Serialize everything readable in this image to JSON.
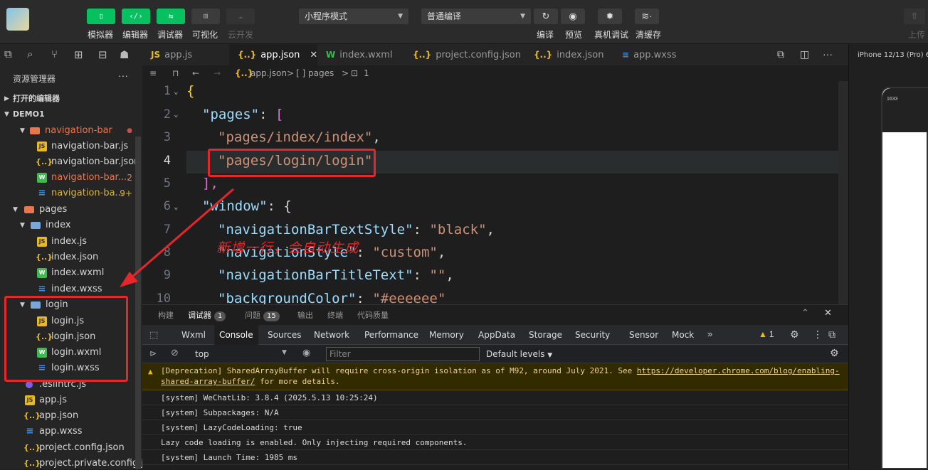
{
  "toolbar": {
    "buttons": [
      {
        "label": "模拟器",
        "icon": "phone-icon"
      },
      {
        "label": "编辑器",
        "icon": "code-icon"
      },
      {
        "label": "调试器",
        "icon": "debug-icon"
      },
      {
        "label": "可视化",
        "icon": "layout-icon"
      },
      {
        "label": "云开发",
        "icon": "cloud-icon"
      }
    ],
    "mode_select": "小程序模式",
    "compile_select": "普通编译",
    "actions": [
      "编译",
      "预览",
      "真机调试",
      "清缓存"
    ],
    "upload": "上传"
  },
  "explorer": {
    "title": "资源管理器",
    "more": "···",
    "open_editors": "打开的编辑器",
    "project": "DEMO1",
    "items": [
      {
        "name": "navigation-bar",
        "type": "folder",
        "badge": "●"
      },
      {
        "name": "navigation-bar.js",
        "type": "js"
      },
      {
        "name": "navigation-bar.json",
        "type": "json"
      },
      {
        "name": "navigation-bar....",
        "type": "wxml",
        "badge": "2"
      },
      {
        "name": "navigation-ba...",
        "type": "wxss",
        "badge": "9+"
      },
      {
        "name": "pages",
        "type": "folder"
      },
      {
        "name": "index",
        "type": "folder"
      },
      {
        "name": "index.js",
        "type": "js"
      },
      {
        "name": "index.json",
        "type": "json"
      },
      {
        "name": "index.wxml",
        "type": "wxml"
      },
      {
        "name": "index.wxss",
        "type": "wxss"
      },
      {
        "name": "login",
        "type": "folder"
      },
      {
        "name": "login.js",
        "type": "js"
      },
      {
        "name": "login.json",
        "type": "json"
      },
      {
        "name": "login.wxml",
        "type": "wxml"
      },
      {
        "name": "login.wxss",
        "type": "wxss"
      },
      {
        "name": ".eslintrc.js",
        "type": "eslint"
      },
      {
        "name": "app.js",
        "type": "js"
      },
      {
        "name": "app.json",
        "type": "json"
      },
      {
        "name": "app.wxss",
        "type": "wxss"
      },
      {
        "name": "project.config.json",
        "type": "json"
      },
      {
        "name": "project.private.config.js...",
        "type": "json"
      }
    ]
  },
  "tabs": [
    {
      "label": "app.js",
      "icon": "JS"
    },
    {
      "label": "app.json",
      "icon": "{..}",
      "active": true
    },
    {
      "label": "index.wxml",
      "icon": "W"
    },
    {
      "label": "project.config.json",
      "icon": "{..}"
    },
    {
      "label": "index.json",
      "icon": "{..}"
    },
    {
      "label": "app.wxss",
      "icon": "≡"
    }
  ],
  "close_glyph": "✕",
  "breadcrumb": {
    "file": "app.json",
    "sep1": ">",
    "node": "[ ] pages",
    "sep2": ">",
    "leaf": "1"
  },
  "code": {
    "line_numbers": [
      "1",
      "2",
      "3",
      "4",
      "5",
      "6",
      "7",
      "8",
      "9",
      "10"
    ],
    "l1": "{",
    "l2_key": "\"pages\"",
    "l2_rest": ": ",
    "l2_br": "[",
    "l3": "\"pages/index/index\"",
    "l3_comma": ",",
    "l4": "\"pages/login/login\"",
    "l5": "],",
    "l6_key": "\"window\"",
    "l6_rest": ": {",
    "l7_key": "\"navigationBarTextStyle\"",
    "l7_val": "\"black\"",
    "l8_key": "\"navigationStyle\"",
    "l8_val": "\"custom\"",
    "l9_key": "\"navigationBarTitleText\"",
    "l9_val": "\"\"",
    "l10_key": "\"backgroundColor\"",
    "l10_val": "\"#eeeeee\""
  },
  "annotation": "新增一行，会自动生成",
  "panel": {
    "tabs": [
      {
        "label": "构建"
      },
      {
        "label": "调试器",
        "badge": "1",
        "active": true
      },
      {
        "label": "问题",
        "badge": "15"
      },
      {
        "label": "输出"
      },
      {
        "label": "终端"
      },
      {
        "label": "代码质量"
      }
    ],
    "devtools_tabs": [
      "Wxml",
      "Console",
      "Sources",
      "Network",
      "Performance",
      "Memory",
      "AppData",
      "Storage",
      "Security",
      "Sensor",
      "Mock"
    ],
    "more": "»",
    "warning_count": "1",
    "context": "top",
    "filter_placeholder": "Filter",
    "levels": "Default levels",
    "logs": {
      "warn_pre": "[Deprecation] SharedArrayBuffer will require cross-origin isolation as of M92, around July 2021. See ",
      "warn_link": "https://developer.chrome.com/blog/enabling-shared-array-buffer/",
      "warn_post": " for more details.",
      "l1": "[system] WeChatLib: 3.8.4 (2025.5.13 10:25:24)",
      "l2": "[system] Subpackages: N/A",
      "l3": "[system] LazyCodeLoading: true",
      "l4": "Lazy code loading is enabled. Only injecting required components.",
      "l5": "[system] Launch Time: 1985 ms"
    }
  },
  "simulator": {
    "device": "iPhone 12/13 (Pro) 6",
    "time": "1633"
  }
}
